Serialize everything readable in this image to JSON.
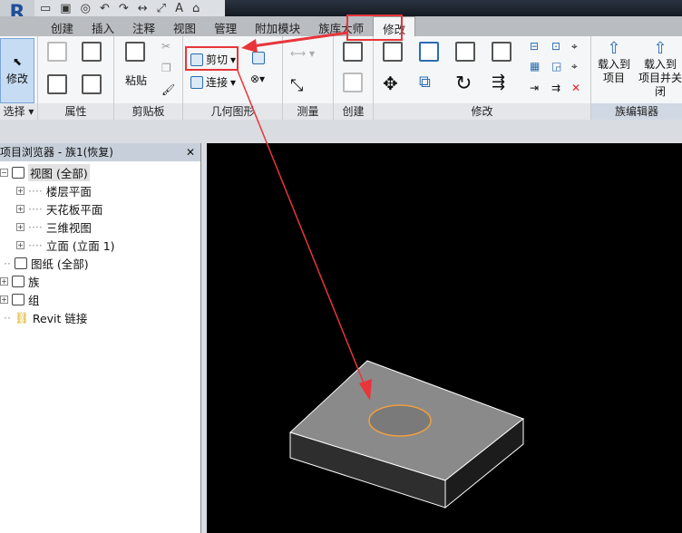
{
  "app": {
    "logo": "R"
  },
  "tabs": [
    {
      "label": "创建"
    },
    {
      "label": "插入"
    },
    {
      "label": "注释"
    },
    {
      "label": "视图"
    },
    {
      "label": "管理"
    },
    {
      "label": "附加模块"
    },
    {
      "label": "族库大师"
    },
    {
      "label": "修改",
      "active": true
    }
  ],
  "ribbon": {
    "select": {
      "modify": "修改",
      "label": "选择"
    },
    "properties": {
      "label": "属性"
    },
    "clipboard": {
      "paste": "粘贴",
      "label": "剪贴板"
    },
    "geometry": {
      "cut": "剪切",
      "join": "连接",
      "label": "几何图形"
    },
    "measure": {
      "label": "测量"
    },
    "create": {
      "label": "创建"
    },
    "modify": {
      "label": "修改"
    },
    "family_editor": {
      "load_into_project": "载入到\n项目",
      "load_close": "载入到\n项目并关闭",
      "label": "族编辑器"
    }
  },
  "browser": {
    "title": "项目浏览器 - 族1(恢复)",
    "close": "✕",
    "items": [
      {
        "label": "视图 (全部)",
        "expander": "−"
      },
      {
        "label": "楼层平面",
        "expander": "+"
      },
      {
        "label": "天花板平面",
        "expander": "+"
      },
      {
        "label": "三维视图",
        "expander": "+"
      },
      {
        "label": "立面 (立面 1)",
        "expander": "+"
      },
      {
        "label": "图纸 (全部)"
      },
      {
        "label": "族",
        "expander": "+"
      },
      {
        "label": "组",
        "expander": "+"
      },
      {
        "label": "Revit 链接"
      }
    ]
  },
  "colors": {
    "annotation": "#e8353a",
    "hole_outline": "#f0a040",
    "viewport_bg": "#000000"
  }
}
